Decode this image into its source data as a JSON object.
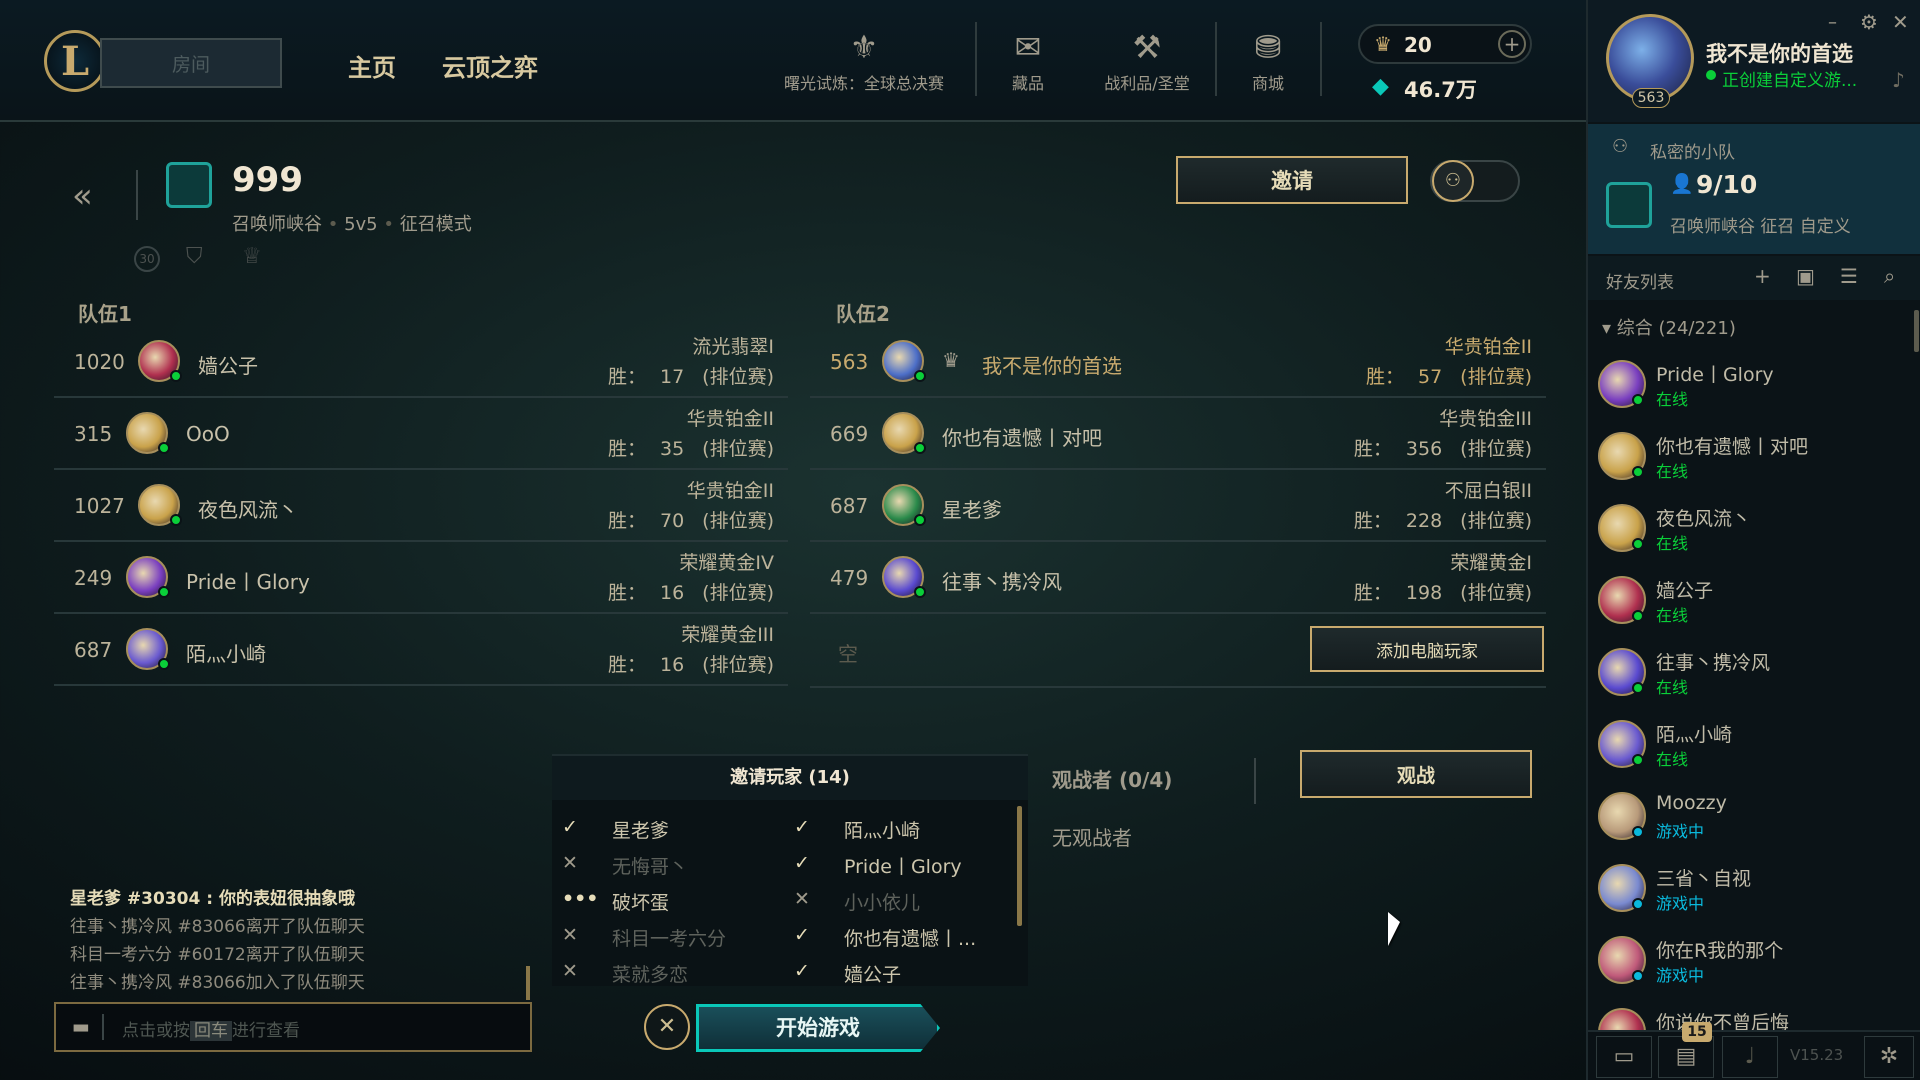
{
  "topbar": {
    "play_label": "房间",
    "nav": [
      "主页",
      "云顶之弈"
    ],
    "icons": [
      {
        "name": "trophy-icon",
        "glyph": "⚜",
        "label": "曙光试炼：全球总决赛"
      },
      {
        "name": "store-bag-icon",
        "glyph": "✉",
        "label": "藏品"
      },
      {
        "name": "loot-icon",
        "glyph": "⚒",
        "label": "战利品/圣堂"
      },
      {
        "name": "shop-coins-icon",
        "glyph": "⛃",
        "label": "商城"
      }
    ],
    "rp": "20",
    "be": "46.7万"
  },
  "profile": {
    "name": "我不是你的首选",
    "status": "正创建自定义游...",
    "level": "563",
    "window_controls": [
      "–",
      "⚙",
      "✕"
    ]
  },
  "lobby": {
    "title_number": "999",
    "subtitle": [
      "召唤师峡谷",
      "5v5",
      "征召模式"
    ],
    "invite_label": "邀请",
    "team1_label": "队伍1",
    "team2_label": "队伍2",
    "wins_prefix": "胜：",
    "team1": [
      {
        "level": "1020",
        "name": "嫱公子",
        "rank": "流光翡翠I",
        "wins": "17",
        "queue": "(排位赛)",
        "color": "#b0304f"
      },
      {
        "level": "315",
        "name": "OoO",
        "rank": "华贵铂金II",
        "wins": "35",
        "queue": "(排位赛)",
        "color": "#c9a24a"
      },
      {
        "level": "1027",
        "name": "夜色风流丶",
        "rank": "华贵铂金II",
        "wins": "70",
        "queue": "(排位赛)",
        "color": "#c9a24a"
      },
      {
        "level": "249",
        "name": "Pride丨Glory",
        "rank": "荣耀黄金IV",
        "wins": "16",
        "queue": "(排位赛)",
        "color": "#7a3fc0"
      },
      {
        "level": "687",
        "name": "陌灬小崎",
        "rank": "荣耀黄金III",
        "wins": "16",
        "queue": "(排位赛)",
        "color": "#6a5ad0"
      }
    ],
    "team2": [
      {
        "level": "563",
        "name": "我不是你的首选",
        "rank": "华贵铂金II",
        "wins": "57",
        "queue": "(排位赛)",
        "color": "#4d6fc8"
      },
      {
        "level": "669",
        "name": "你也有遗憾丨对吧",
        "rank": "华贵铂金III",
        "wins": "356",
        "queue": "(排位赛)",
        "color": "#c9a24a"
      },
      {
        "level": "687",
        "name": "星老爹",
        "rank": "不屈白银II",
        "wins": "228",
        "queue": "(排位赛)",
        "color": "#2a8a4a"
      },
      {
        "level": "479",
        "name": "往事丶携冷风",
        "rank": "荣耀黄金I",
        "wins": "198",
        "queue": "(排位赛)",
        "color": "#5a4ad0"
      }
    ],
    "empty_slot": "空",
    "add_bot": "添加电脑玩家",
    "spectators_label": "观战者 (0/4)",
    "spectate_btn": "观战",
    "no_spectators": "无观战者",
    "start_game": "开始游戏"
  },
  "invite_list": {
    "title": "邀请玩家 (14)",
    "left": [
      {
        "mark": "✓",
        "name": "星老爹",
        "dim": false
      },
      {
        "mark": "✕",
        "name": "无悔哥丶",
        "dim": true
      },
      {
        "mark": "•••",
        "name": "破坏蛋",
        "dim": false
      },
      {
        "mark": "✕",
        "name": "科目一考六分",
        "dim": true
      },
      {
        "mark": "✕",
        "name": "菜就多恋",
        "dim": true
      }
    ],
    "right": [
      {
        "mark": "✓",
        "name": "陌灬小崎",
        "dim": false
      },
      {
        "mark": "✓",
        "name": "Pride丨Glory",
        "dim": false
      },
      {
        "mark": "✕",
        "name": "小小依儿",
        "dim": true
      },
      {
        "mark": "✓",
        "name": "你也有遗憾丨...",
        "dim": false
      },
      {
        "mark": "✓",
        "name": "嫱公子",
        "dim": false
      }
    ]
  },
  "chat": {
    "lines": [
      {
        "text": "星老爹 #30304 : 你的表妞很抽象哦",
        "bright": true
      },
      {
        "text": "往事丶携冷风 #83066离开了队伍聊天",
        "bright": false
      },
      {
        "text": "科目一考六分 #60172离开了队伍聊天",
        "bright": false
      },
      {
        "text": "往事丶携冷风 #83066加入了队伍聊天",
        "bright": false
      }
    ],
    "input_prefix": "点击或按",
    "input_key": "回车",
    "input_suffix": "进行查看"
  },
  "social": {
    "party_header": "私密的小队",
    "party_count": "9/10",
    "party_mode": "召唤师峡谷 征召 自定义",
    "friends_header": "好友列表",
    "group_label": "综合 (24/221)",
    "friends": [
      {
        "name": "Pride丨Glory",
        "status": "在线",
        "type": "online",
        "color": "#7a3fc0"
      },
      {
        "name": "你也有遗憾丨对吧",
        "status": "在线",
        "type": "online",
        "color": "#c9a24a"
      },
      {
        "name": "夜色风流丶",
        "status": "在线",
        "type": "online",
        "color": "#c9a24a"
      },
      {
        "name": "嫱公子",
        "status": "在线",
        "type": "online",
        "color": "#b0304f"
      },
      {
        "name": "往事丶携冷风",
        "status": "在线",
        "type": "online",
        "color": "#5a4ad0"
      },
      {
        "name": "陌灬小崎",
        "status": "在线",
        "type": "online",
        "color": "#6a5ad0"
      },
      {
        "name": "Moozzy",
        "status": "游戏中",
        "type": "ingame",
        "color": "#b89a7a"
      },
      {
        "name": "三省丶自视",
        "status": "游戏中",
        "type": "ingame",
        "color": "#7a8ad0"
      },
      {
        "name": "你在R我的那个",
        "status": "游戏中",
        "type": "ingame",
        "color": "#c05a7a"
      },
      {
        "name": "你说你不曾后悔",
        "status": "",
        "type": "online",
        "color": "#b0304f"
      }
    ],
    "bottom_badge": "15",
    "version": "V15.23"
  }
}
